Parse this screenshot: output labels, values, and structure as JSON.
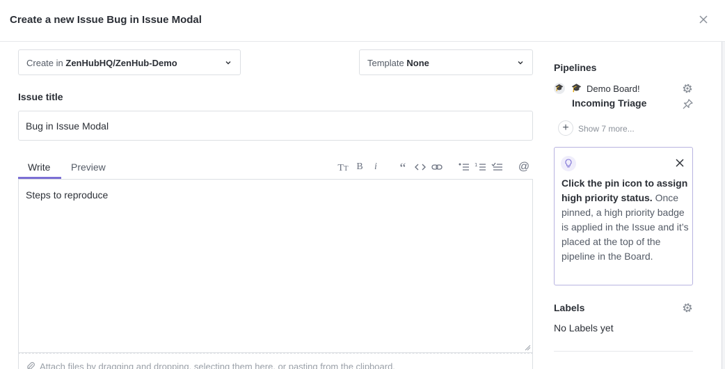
{
  "header": {
    "title": "Create a new Issue Bug in Issue Modal"
  },
  "repo_select": {
    "prefix": "Create in",
    "value": "ZenHubHQ/ZenHub-Demo"
  },
  "template_select": {
    "prefix": "Template",
    "value": "None"
  },
  "issue_title": {
    "label": "Issue title",
    "value": "Bug in Issue Modal"
  },
  "editor": {
    "tabs": [
      {
        "label": "Write",
        "active": true
      },
      {
        "label": "Preview",
        "active": false
      }
    ],
    "toolbar": [
      "text-size-icon",
      "bold-icon",
      "italic-icon",
      "quote-icon",
      "code-icon",
      "link-icon",
      "bulleted-list-icon",
      "numbered-list-icon",
      "task-list-icon",
      "mention-icon"
    ],
    "body": "Steps to reproduce",
    "attach_hint": "Attach files by dragging and dropping, selecting them here, or pasting from the clipboard."
  },
  "pipelines": {
    "title": "Pipelines",
    "board_name": "Demo Board!",
    "pipeline_name": "Incoming Triage",
    "show_more": "Show 7 more..."
  },
  "tip": {
    "bold": "Click the pin icon to assign high priority status.",
    "rest": " Once pinned, a high priority badge is applied in the Issue and it’s placed at the top of the pipeline in the Board."
  },
  "labels": {
    "title": "Labels",
    "empty": "No Labels yet"
  },
  "colors": {
    "accent": "#7b6fd4",
    "tip_border": "#b8b3e0",
    "border": "#dcdfe3"
  }
}
